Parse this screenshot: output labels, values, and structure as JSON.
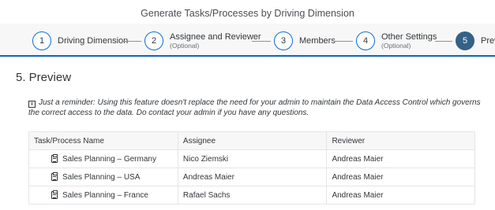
{
  "header": {
    "title": "Generate Tasks/Processes by Driving Dimension"
  },
  "wizard": {
    "steps": [
      {
        "number": "1",
        "label": "Driving Dimension",
        "optional": ""
      },
      {
        "number": "2",
        "label": "Assignee and Reviewer",
        "optional": "(Optional)"
      },
      {
        "number": "3",
        "label": "Members",
        "optional": ""
      },
      {
        "number": "4",
        "label": "Other Settings",
        "optional": "(Optional)"
      },
      {
        "number": "5",
        "label": "Preview",
        "optional": ""
      }
    ],
    "active_step": 5,
    "accent_color": "#0a6ed1",
    "active_color": "#346187"
  },
  "section": {
    "title": "5. Preview",
    "notice_icon": "info-icon",
    "notice": "Just a reminder: Using this feature doesn't replace the need for your admin to maintain the Data Access Control which governs the correct access to the data. Do contact your admin if you have any questions."
  },
  "table": {
    "columns": [
      "Task/Process Name",
      "Assignee",
      "Reviewer"
    ],
    "row_icon": "clipboard-icon",
    "rows": [
      {
        "name": "Sales Planning – Germany",
        "assignee": "Nico Ziemski",
        "reviewer": "Andreas Maier"
      },
      {
        "name": "Sales Planning – USA",
        "assignee": "Andreas Maier",
        "reviewer": "Andreas Maier"
      },
      {
        "name": "Sales Planning – France",
        "assignee": "Rafael Sachs",
        "reviewer": "Andreas Maier"
      }
    ]
  }
}
